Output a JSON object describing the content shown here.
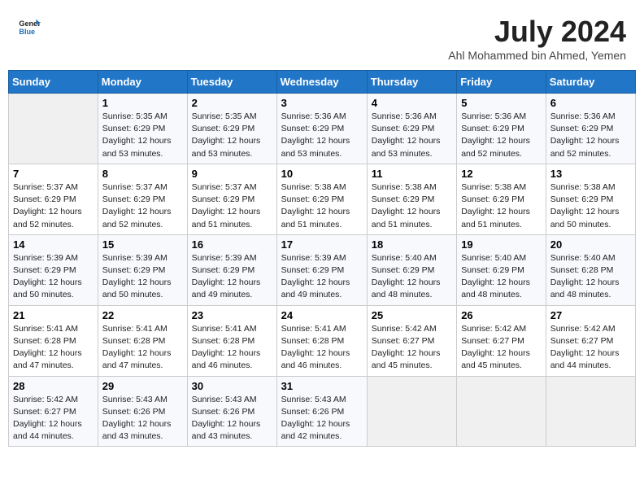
{
  "header": {
    "logo_line1": "General",
    "logo_line2": "Blue",
    "month_year": "July 2024",
    "location": "Ahl Mohammed bin Ahmed, Yemen"
  },
  "weekdays": [
    "Sunday",
    "Monday",
    "Tuesday",
    "Wednesday",
    "Thursday",
    "Friday",
    "Saturday"
  ],
  "weeks": [
    [
      {
        "day": "",
        "sunrise": "",
        "sunset": "",
        "daylight": ""
      },
      {
        "day": "1",
        "sunrise": "Sunrise: 5:35 AM",
        "sunset": "Sunset: 6:29 PM",
        "daylight": "Daylight: 12 hours and 53 minutes."
      },
      {
        "day": "2",
        "sunrise": "Sunrise: 5:35 AM",
        "sunset": "Sunset: 6:29 PM",
        "daylight": "Daylight: 12 hours and 53 minutes."
      },
      {
        "day": "3",
        "sunrise": "Sunrise: 5:36 AM",
        "sunset": "Sunset: 6:29 PM",
        "daylight": "Daylight: 12 hours and 53 minutes."
      },
      {
        "day": "4",
        "sunrise": "Sunrise: 5:36 AM",
        "sunset": "Sunset: 6:29 PM",
        "daylight": "Daylight: 12 hours and 53 minutes."
      },
      {
        "day": "5",
        "sunrise": "Sunrise: 5:36 AM",
        "sunset": "Sunset: 6:29 PM",
        "daylight": "Daylight: 12 hours and 52 minutes."
      },
      {
        "day": "6",
        "sunrise": "Sunrise: 5:36 AM",
        "sunset": "Sunset: 6:29 PM",
        "daylight": "Daylight: 12 hours and 52 minutes."
      }
    ],
    [
      {
        "day": "7",
        "sunrise": "Sunrise: 5:37 AM",
        "sunset": "Sunset: 6:29 PM",
        "daylight": "Daylight: 12 hours and 52 minutes."
      },
      {
        "day": "8",
        "sunrise": "Sunrise: 5:37 AM",
        "sunset": "Sunset: 6:29 PM",
        "daylight": "Daylight: 12 hours and 52 minutes."
      },
      {
        "day": "9",
        "sunrise": "Sunrise: 5:37 AM",
        "sunset": "Sunset: 6:29 PM",
        "daylight": "Daylight: 12 hours and 51 minutes."
      },
      {
        "day": "10",
        "sunrise": "Sunrise: 5:38 AM",
        "sunset": "Sunset: 6:29 PM",
        "daylight": "Daylight: 12 hours and 51 minutes."
      },
      {
        "day": "11",
        "sunrise": "Sunrise: 5:38 AM",
        "sunset": "Sunset: 6:29 PM",
        "daylight": "Daylight: 12 hours and 51 minutes."
      },
      {
        "day": "12",
        "sunrise": "Sunrise: 5:38 AM",
        "sunset": "Sunset: 6:29 PM",
        "daylight": "Daylight: 12 hours and 51 minutes."
      },
      {
        "day": "13",
        "sunrise": "Sunrise: 5:38 AM",
        "sunset": "Sunset: 6:29 PM",
        "daylight": "Daylight: 12 hours and 50 minutes."
      }
    ],
    [
      {
        "day": "14",
        "sunrise": "Sunrise: 5:39 AM",
        "sunset": "Sunset: 6:29 PM",
        "daylight": "Daylight: 12 hours and 50 minutes."
      },
      {
        "day": "15",
        "sunrise": "Sunrise: 5:39 AM",
        "sunset": "Sunset: 6:29 PM",
        "daylight": "Daylight: 12 hours and 50 minutes."
      },
      {
        "day": "16",
        "sunrise": "Sunrise: 5:39 AM",
        "sunset": "Sunset: 6:29 PM",
        "daylight": "Daylight: 12 hours and 49 minutes."
      },
      {
        "day": "17",
        "sunrise": "Sunrise: 5:39 AM",
        "sunset": "Sunset: 6:29 PM",
        "daylight": "Daylight: 12 hours and 49 minutes."
      },
      {
        "day": "18",
        "sunrise": "Sunrise: 5:40 AM",
        "sunset": "Sunset: 6:29 PM",
        "daylight": "Daylight: 12 hours and 48 minutes."
      },
      {
        "day": "19",
        "sunrise": "Sunrise: 5:40 AM",
        "sunset": "Sunset: 6:29 PM",
        "daylight": "Daylight: 12 hours and 48 minutes."
      },
      {
        "day": "20",
        "sunrise": "Sunrise: 5:40 AM",
        "sunset": "Sunset: 6:28 PM",
        "daylight": "Daylight: 12 hours and 48 minutes."
      }
    ],
    [
      {
        "day": "21",
        "sunrise": "Sunrise: 5:41 AM",
        "sunset": "Sunset: 6:28 PM",
        "daylight": "Daylight: 12 hours and 47 minutes."
      },
      {
        "day": "22",
        "sunrise": "Sunrise: 5:41 AM",
        "sunset": "Sunset: 6:28 PM",
        "daylight": "Daylight: 12 hours and 47 minutes."
      },
      {
        "day": "23",
        "sunrise": "Sunrise: 5:41 AM",
        "sunset": "Sunset: 6:28 PM",
        "daylight": "Daylight: 12 hours and 46 minutes."
      },
      {
        "day": "24",
        "sunrise": "Sunrise: 5:41 AM",
        "sunset": "Sunset: 6:28 PM",
        "daylight": "Daylight: 12 hours and 46 minutes."
      },
      {
        "day": "25",
        "sunrise": "Sunrise: 5:42 AM",
        "sunset": "Sunset: 6:27 PM",
        "daylight": "Daylight: 12 hours and 45 minutes."
      },
      {
        "day": "26",
        "sunrise": "Sunrise: 5:42 AM",
        "sunset": "Sunset: 6:27 PM",
        "daylight": "Daylight: 12 hours and 45 minutes."
      },
      {
        "day": "27",
        "sunrise": "Sunrise: 5:42 AM",
        "sunset": "Sunset: 6:27 PM",
        "daylight": "Daylight: 12 hours and 44 minutes."
      }
    ],
    [
      {
        "day": "28",
        "sunrise": "Sunrise: 5:42 AM",
        "sunset": "Sunset: 6:27 PM",
        "daylight": "Daylight: 12 hours and 44 minutes."
      },
      {
        "day": "29",
        "sunrise": "Sunrise: 5:43 AM",
        "sunset": "Sunset: 6:26 PM",
        "daylight": "Daylight: 12 hours and 43 minutes."
      },
      {
        "day": "30",
        "sunrise": "Sunrise: 5:43 AM",
        "sunset": "Sunset: 6:26 PM",
        "daylight": "Daylight: 12 hours and 43 minutes."
      },
      {
        "day": "31",
        "sunrise": "Sunrise: 5:43 AM",
        "sunset": "Sunset: 6:26 PM",
        "daylight": "Daylight: 12 hours and 42 minutes."
      },
      {
        "day": "",
        "sunrise": "",
        "sunset": "",
        "daylight": ""
      },
      {
        "day": "",
        "sunrise": "",
        "sunset": "",
        "daylight": ""
      },
      {
        "day": "",
        "sunrise": "",
        "sunset": "",
        "daylight": ""
      }
    ]
  ]
}
